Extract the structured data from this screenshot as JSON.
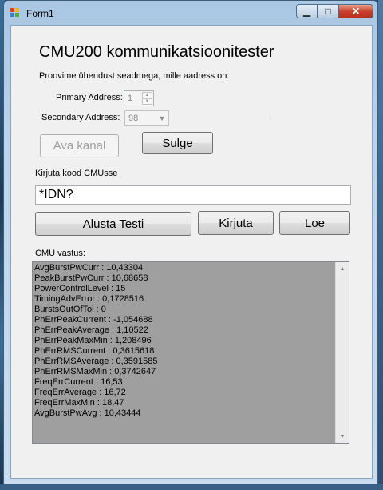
{
  "window": {
    "title": "Form1",
    "minimize": "▁",
    "maximize": "□",
    "close": "✕"
  },
  "heading": "CMU200 kommunikatsioonitester",
  "intro": "Proovime ühendust seadmega, mille aadress on:",
  "primary": {
    "label": "Primary Address:",
    "value": "1"
  },
  "secondary": {
    "label": "Secondary Address:",
    "value": "98"
  },
  "buttons": {
    "open": "Ava kanal",
    "close": "Sulge",
    "start": "Alusta Testi",
    "write": "Kirjuta",
    "read": "Loe"
  },
  "code_label": "Kirjuta kood CMUsse",
  "code_value": "*IDN?",
  "response_label": "CMU vastus:",
  "response_lines": [
    "AvgBurstPwCurr : 10,43304",
    "PeakBurstPwCurr : 10,68658",
    "PowerControlLevel : 15",
    "TimingAdvError : 0,1728516",
    "BurstsOutOfTol : 0",
    "PhErrPeakCurrent : -1,054688",
    "PhErrPeakAverage : 1,10522",
    "PhErrPeakMaxMin : 1,208496",
    "PhErrRMSCurrent : 0,3615618",
    "PhErrRMSAverage : 0,3591585",
    "PhErrRMSMaxMin : 0,3742647",
    "FreqErrCurrent : 16,53",
    "FreqErrAverage : 16,72",
    "FreqErrMaxMin : 18,47",
    "AvgBurstPwAvg : 10,43444"
  ],
  "colors": {
    "memo_bg": "#9f9f9f",
    "close_btn": "#c8432b"
  }
}
